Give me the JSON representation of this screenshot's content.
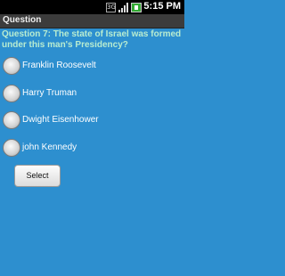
{
  "status_bar": {
    "time": "5:15 PM",
    "network_label": "3G",
    "icons": [
      "3g-icon",
      "signal-icon",
      "battery-icon"
    ]
  },
  "title_bar": {
    "title": "Question"
  },
  "question": {
    "text": "Question 7: The state of Israel was formed under this man's Presidency?"
  },
  "options": [
    {
      "label": "Franklin Roosevelt",
      "selected": false
    },
    {
      "label": "Harry Truman",
      "selected": false
    },
    {
      "label": "Dwight Eisenhower",
      "selected": false
    },
    {
      "label": "john Kennedy",
      "selected": false
    }
  ],
  "actions": {
    "select_label": "Select"
  },
  "colors": {
    "background": "#2d8fcf",
    "question_text": "#b8ecd0",
    "title_bar": "#3c3c3c",
    "status_bar": "#000000"
  }
}
